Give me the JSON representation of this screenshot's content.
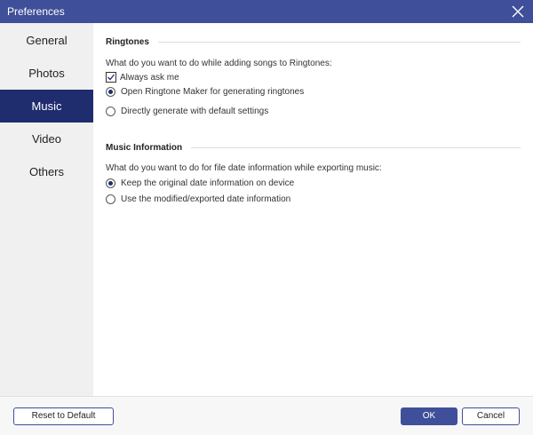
{
  "window": {
    "title": "Preferences"
  },
  "sidebar": {
    "items": [
      {
        "label": "General",
        "active": false
      },
      {
        "label": "Photos",
        "active": false
      },
      {
        "label": "Music",
        "active": true
      },
      {
        "label": "Video",
        "active": false
      },
      {
        "label": "Others",
        "active": false
      }
    ]
  },
  "ringtones": {
    "heading": "Ringtones",
    "question": "What do you want to do while adding songs to Ringtones:",
    "always_ask": {
      "label": "Always ask me",
      "checked": true
    },
    "options": [
      {
        "label": "Open Ringtone Maker for generating ringtones",
        "selected": true
      },
      {
        "label": "Directly generate with default settings",
        "selected": false
      }
    ]
  },
  "music_info": {
    "heading": "Music Information",
    "question": "What do you want to do for file date information while exporting music:",
    "options": [
      {
        "label": "Keep the original date information on device",
        "selected": true
      },
      {
        "label": "Use the modified/exported date information",
        "selected": false
      }
    ]
  },
  "footer": {
    "reset_label": "Reset to Default",
    "ok_label": "OK",
    "cancel_label": "Cancel"
  },
  "colors": {
    "accent": "#3f4f99",
    "nav_active": "#1f2c6e",
    "sidebar_bg": "#f0f0f0"
  }
}
